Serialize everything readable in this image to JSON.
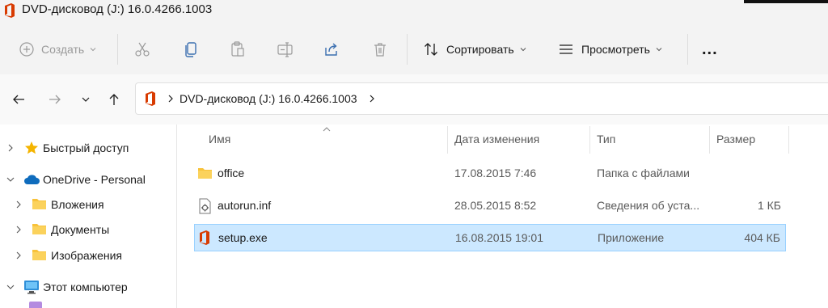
{
  "window": {
    "title": "DVD-дисковод (J:) 16.0.4266.1003"
  },
  "toolbar": {
    "create_label": "Создать",
    "sort_label": "Сортировать",
    "view_label": "Просмотреть",
    "more_label": "..."
  },
  "address": {
    "path": "DVD-дисковод (J:) 16.0.4266.1003"
  },
  "sidebar": {
    "items": [
      {
        "label": "Быстрый доступ",
        "icon": "star-icon"
      },
      {
        "label": "OneDrive - Personal",
        "icon": "cloud-icon"
      },
      {
        "label": "Вложения",
        "icon": "folder-icon"
      },
      {
        "label": "Документы",
        "icon": "folder-icon"
      },
      {
        "label": "Изображения",
        "icon": "folder-icon"
      },
      {
        "label": "Этот компьютер",
        "icon": "computer-icon"
      }
    ]
  },
  "columns": {
    "name": "Имя",
    "date": "Дата изменения",
    "type": "Тип",
    "size": "Размер"
  },
  "files": [
    {
      "name": "office",
      "date": "17.08.2015 7:46",
      "type": "Папка с файлами",
      "size": "",
      "icon": "folder-icon"
    },
    {
      "name": "autorun.inf",
      "date": "28.05.2015 8:52",
      "type": "Сведения об уста...",
      "size": "1 КБ",
      "icon": "settings-file-icon"
    },
    {
      "name": "setup.exe",
      "date": "16.08.2015 19:01",
      "type": "Приложение",
      "size": "404 КБ",
      "icon": "office-icon",
      "selected": true
    }
  ],
  "colors": {
    "selection_bg": "#cce8ff",
    "selection_border": "#99d1ff",
    "office_red": "#d83b01",
    "folder_yellow": "#f8c23a",
    "onedrive_blue": "#0f6cbd"
  }
}
